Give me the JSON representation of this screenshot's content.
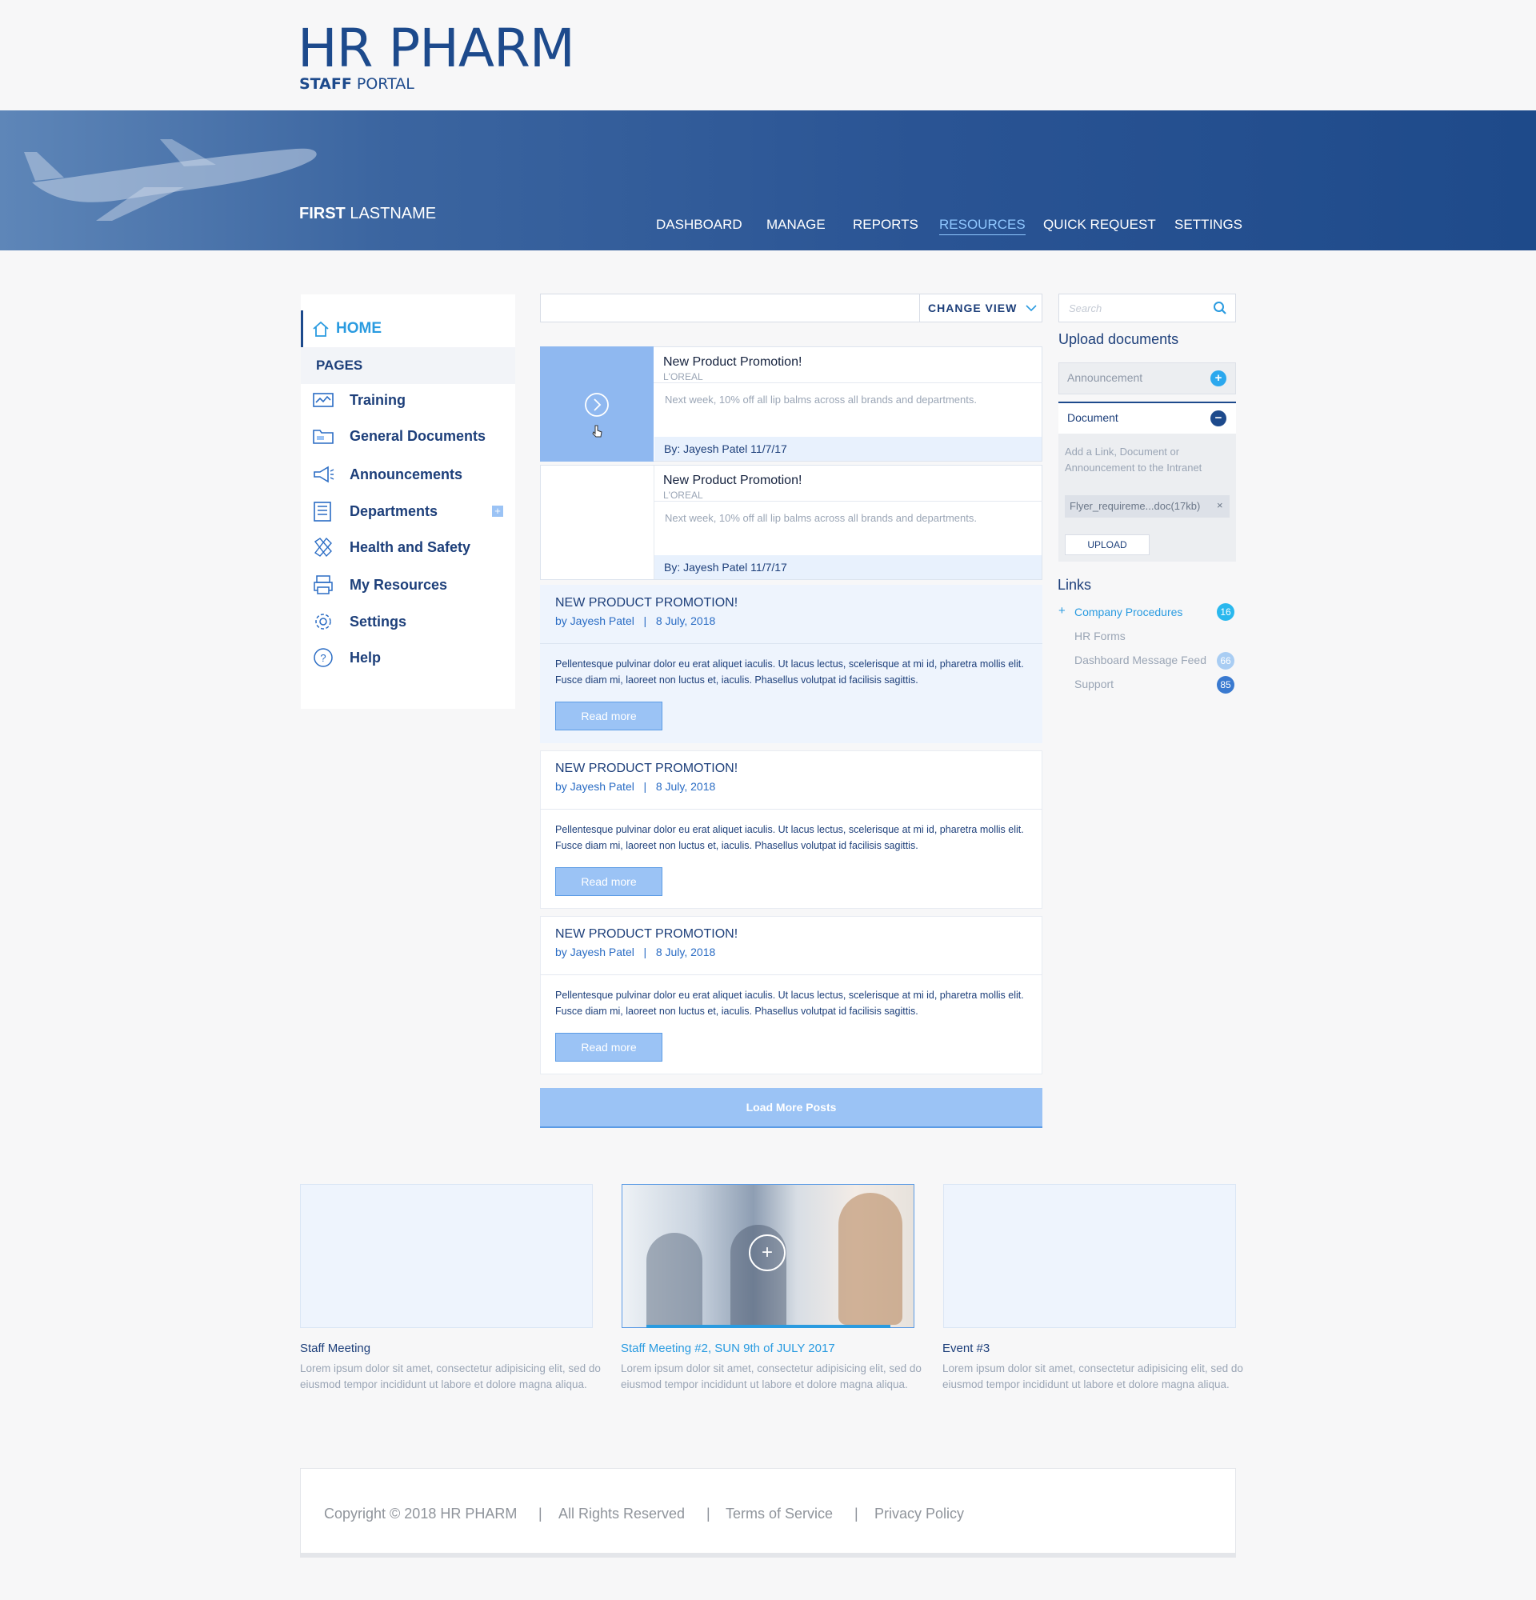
{
  "header": {
    "logo_title": "HR PHARM",
    "logo_sub_bold": "STAFF",
    "logo_sub_rest": " PORTAL",
    "user_first": "FIRST",
    "user_last": " LASTNAME",
    "nav": [
      "DASHBOARD",
      "MANAGE",
      "REPORTS",
      "RESOURCES",
      "QUICK REQUEST",
      "SETTINGS"
    ],
    "active_nav": "RESOURCES"
  },
  "sidebar": {
    "home": "HOME",
    "pages": "PAGES",
    "items": [
      {
        "label": "Training",
        "icon": "training-icon"
      },
      {
        "label": "General Documents",
        "icon": "folder-icon"
      },
      {
        "label": "Announcements",
        "icon": "megaphone-icon"
      },
      {
        "label": "Departments",
        "icon": "building-icon"
      },
      {
        "label": "Health and Safety",
        "icon": "bandage-icon"
      },
      {
        "label": "My Resources",
        "icon": "printer-icon"
      },
      {
        "label": "Settings",
        "icon": "gear-icon"
      },
      {
        "label": "Help",
        "icon": "question-icon"
      }
    ]
  },
  "feed": {
    "change_view": "CHANGE VIEW",
    "cards": [
      {
        "title": "New Product Promotion!",
        "brand": "L'OREAL",
        "desc": "Next week, 10% off all lip balms across all brands and departments.",
        "footer": "By: Jayesh Patel 11/7/17"
      },
      {
        "title": "New Product Promotion!",
        "brand": "L'OREAL",
        "desc": "Next week, 10% off all lip balms across all brands and departments.",
        "footer": "By: Jayesh Patel 11/7/17"
      }
    ],
    "posts": [
      {
        "title": "NEW PRODUCT PROMOTION!",
        "author": "by Jayesh Patel",
        "sep": "|",
        "date": "8 July, 2018",
        "body": "Pellentesque pulvinar dolor eu erat aliquet iaculis. Ut lacus lectus, scelerisque at mi id, pharetra mollis elit. Fusce diam mi, laoreet non luctus et, iaculis. Phasellus volutpat id facilisis sagittis.",
        "button": "Read more"
      },
      {
        "title": "NEW PRODUCT PROMOTION!",
        "author": "by Jayesh Patel",
        "sep": "|",
        "date": "8 July, 2018",
        "body": "Pellentesque pulvinar dolor eu erat aliquet iaculis. Ut lacus lectus, scelerisque at mi id, pharetra mollis elit. Fusce diam mi, laoreet non luctus et, iaculis. Phasellus volutpat id facilisis sagittis.",
        "button": "Read more"
      },
      {
        "title": "NEW PRODUCT PROMOTION!",
        "author": "by Jayesh Patel",
        "sep": "|",
        "date": "8 July, 2018",
        "body": "Pellentesque pulvinar dolor eu erat aliquet iaculis. Ut lacus lectus, scelerisque at mi id, pharetra mollis elit. Fusce diam mi, laoreet non luctus et, iaculis. Phasellus volutpat id facilisis sagittis.",
        "button": "Read more"
      }
    ],
    "load_more": "Load More Posts"
  },
  "right": {
    "search_placeholder": "Search",
    "upload_title": "Upload documents",
    "announcement": "Announcement",
    "document": "Document",
    "hint": "Add a Link, Document or Announcement to the Intranet",
    "file": "Flyer_requireme...doc(17kb)",
    "upload_button": "UPLOAD",
    "links_title": "Links",
    "links": [
      {
        "label": "Company Procedures",
        "badge": "16"
      },
      {
        "label": "HR Forms",
        "badge": ""
      },
      {
        "label": "Dashboard Message Feed",
        "badge": "66"
      },
      {
        "label": "Support",
        "badge": "85"
      }
    ]
  },
  "events": [
    {
      "title": "Staff Meeting",
      "desc": "Lorem ipsum dolor sit amet, consectetur adipisicing elit, sed do eiusmod tempor incididunt ut labore et dolore magna aliqua."
    },
    {
      "title": "Staff Meeting #2, SUN 9th of JULY 2017",
      "desc": "Lorem ipsum dolor sit amet, consectetur adipisicing elit, sed do eiusmod tempor incididunt ut labore et dolore magna aliqua."
    },
    {
      "title": "Event #3",
      "desc": "Lorem ipsum dolor sit amet, consectetur adipisicing elit, sed do eiusmod tempor incididunt ut labore et dolore magna aliqua."
    }
  ],
  "footer": {
    "copyright": "Copyright © 2018 HR PHARM",
    "rights": "All Rights Reserved",
    "terms": "Terms of Service",
    "privacy": "Privacy Policy",
    "sep": "|"
  },
  "colors": {
    "brand": "#1d4a8c",
    "accent": "#2a9be0",
    "button": "#9bc3f5"
  }
}
